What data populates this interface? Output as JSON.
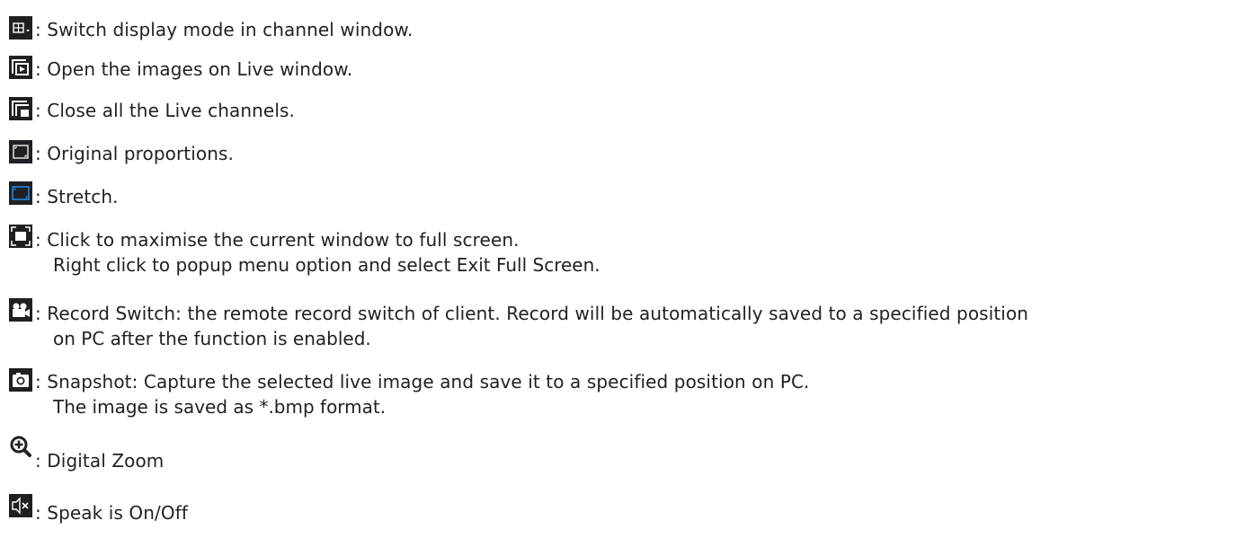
{
  "items": [
    {
      "icon": "display-mode-icon",
      "text": ": Switch display mode in channel window."
    },
    {
      "icon": "open-live-icon",
      "text": ": Open the images on Live window."
    },
    {
      "icon": "close-live-icon",
      "text": ": Close all the Live channels."
    },
    {
      "icon": "original-proportions-icon",
      "text": ": Original proportions."
    },
    {
      "icon": "stretch-icon",
      "text": ": Stretch."
    },
    {
      "icon": "fullscreen-icon",
      "text": ": Click to maximise the current window to full screen.",
      "text2": "Right click to popup menu option and select Exit Full Screen."
    },
    {
      "icon": "record-icon",
      "text": ": Record Switch: the remote record switch of client. Record will be automatically saved to a specified position",
      "text2": "on PC after the function is enabled."
    },
    {
      "icon": "snapshot-icon",
      "text": ": Snapshot: Capture the selected live image and save it to a specified position on PC.",
      "text2": "The image is saved as *.bmp format."
    },
    {
      "icon": "zoom-icon",
      "text": ": Digital Zoom"
    },
    {
      "icon": "speaker-mute-icon",
      "text": ": Speak is On/Off"
    }
  ],
  "colors": {
    "text": "#231f20",
    "icon_dark": "#1f2023",
    "icon_blue": "#1e88e5",
    "icon_white": "#ffffff"
  }
}
